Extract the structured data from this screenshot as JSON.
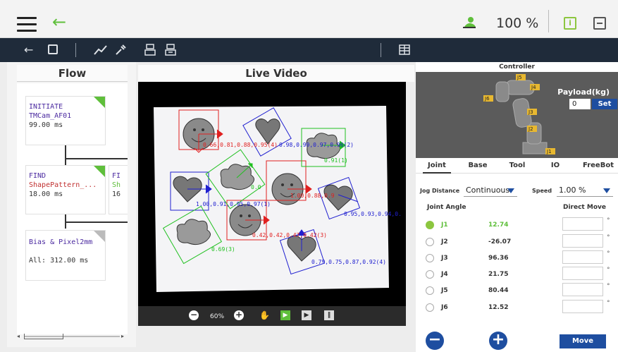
{
  "topbar": {
    "zoom": "100 %",
    "icons": [
      "menu-icon",
      "back-arrow-icon",
      "user-icon",
      "info-icon",
      "panel-icon"
    ]
  },
  "toolbar": {
    "icons": [
      "back-icon",
      "save-icon",
      "path-icon",
      "tool-icon",
      "robot-io-icon",
      "robot-config-icon",
      "table-icon"
    ]
  },
  "flow": {
    "title": "Flow",
    "nodes": [
      {
        "line1": "INITIATE",
        "line2": "TMCam_AF01",
        "line3": "99.00 ms"
      },
      {
        "line1": "FIND",
        "line2": "ShapePattern_...",
        "line3": "18.00 ms"
      },
      {
        "line1": "FI",
        "line2": "Sh",
        "line3": "16"
      },
      {
        "line1": "Bias & Pixel2mm",
        "line2": "All: 312.00 ms"
      }
    ]
  },
  "video": {
    "title": "Live Video",
    "zoom": "60%",
    "detections": [
      "0.66,0.81,0.88,0.95(4)",
      "0.98,0.99,0.97,0.96(2)",
      "0.91(1)",
      "1.00,0.91,0.95,0.97(1)",
      "1.00,0.88,0.9",
      "0.95,0.93,0.94,0.",
      "0.42,0.42,0.47,0.42(3)",
      "0.79,0.75,0.87,0.92(4)",
      "0.0",
      "0.69(3)"
    ]
  },
  "controller": {
    "title": "Controller",
    "payload_label": "Payload(kg)",
    "payload_value": "0",
    "set_label": "Set",
    "joint_labels_overlay": [
      "J5",
      "J4",
      "J6",
      "J3",
      "J2",
      "J1"
    ],
    "tabs": [
      "Joint",
      "Base",
      "Tool",
      "IO",
      "FreeBot"
    ],
    "jog_distance_label": "Jog Distance",
    "jog_distance_value": "Continuous",
    "speed_label": "Speed",
    "speed_value": "1.00 %",
    "joint_angle_label": "Joint Angle",
    "direct_move_label": "Direct Move",
    "joints": [
      {
        "name": "J1",
        "value": "12.74"
      },
      {
        "name": "J2",
        "value": "-26.07"
      },
      {
        "name": "J3",
        "value": "96.36"
      },
      {
        "name": "J4",
        "value": "21.75"
      },
      {
        "name": "J5",
        "value": "80.44"
      },
      {
        "name": "J6",
        "value": "12.52"
      }
    ],
    "degree_symbol": "°",
    "minus_label": "−",
    "plus_label": "+",
    "move_label": "Move"
  }
}
